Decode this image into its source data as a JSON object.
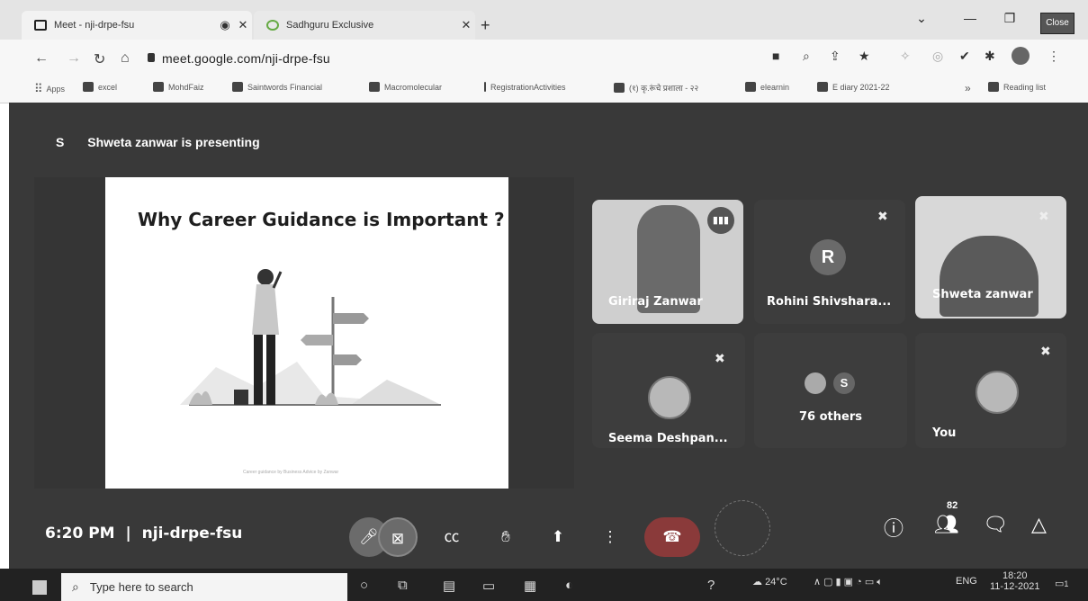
{
  "browser": {
    "tabs": [
      {
        "title": "Meet - nji-drpe-fsu",
        "audio_icon": "◉"
      },
      {
        "title": "Sadhguru Exclusive"
      }
    ],
    "new_tab": "+",
    "close_label": "Close",
    "url": "meet.google.com/nji-drpe-fsu",
    "bookmarks": [
      "Apps",
      "excel",
      "MohdFaiz",
      "Saintwords Financial",
      "Macromolecular",
      "RegistrationActivities",
      "(१) कृ.रूंचे प्रशाला - २२",
      "elearnin",
      "E diary 2021-22",
      "Reading list"
    ],
    "bookmarks_more": "»"
  },
  "meet": {
    "presenter_initial": "S",
    "presenting_text": "Shweta zanwar is presenting",
    "slide_title": "Why Career Guidance is Important ?",
    "slide_footer": "Career guidance by Business Advice by Zanwar",
    "participants": [
      {
        "name": "Giriraj Zanwar"
      },
      {
        "name": "Rohini Shivshara...",
        "initial": "R"
      },
      {
        "name": "Shweta zanwar"
      },
      {
        "name": "Seema Deshpan..."
      },
      {
        "name": "76 others",
        "initial": "S"
      },
      {
        "name": "You"
      }
    ],
    "time": "6:20 PM",
    "separator": "|",
    "meeting_code": "nji-drpe-fsu",
    "people_count": "82",
    "colors": {
      "end_call": "#8a3a3a",
      "muted_btn": "#6b6b6b"
    }
  },
  "taskbar": {
    "search_placeholder": "Type here to search",
    "weather": "24°C",
    "language": "ENG",
    "time": "18:20",
    "date": "11-12-2021",
    "notification_count": "1"
  }
}
